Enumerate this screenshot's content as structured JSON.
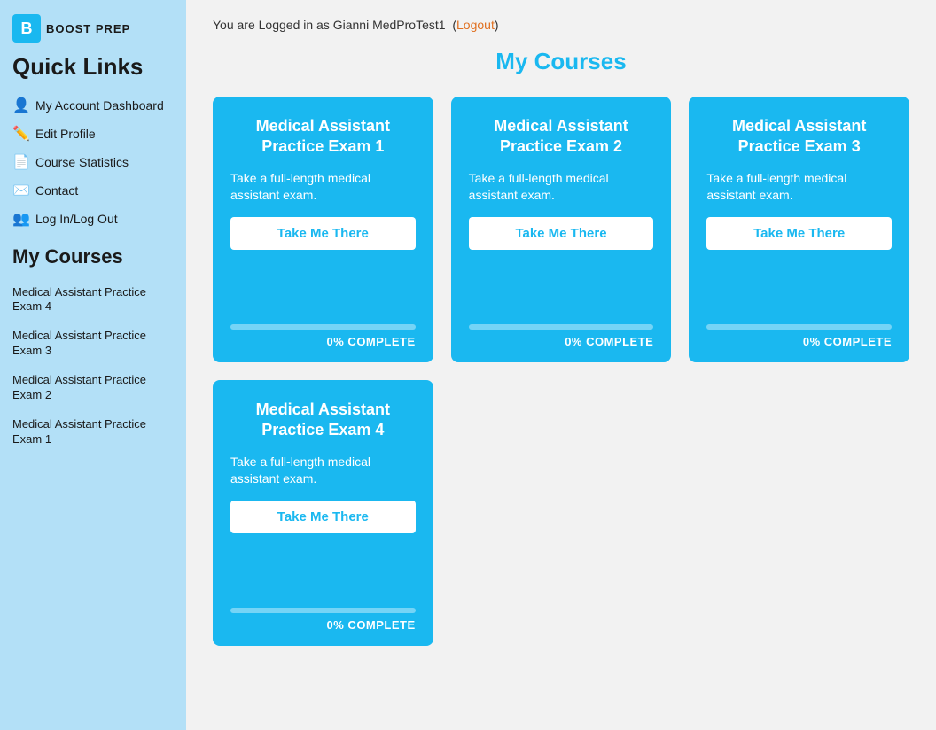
{
  "sidebar": {
    "logo_letter": "B",
    "logo_text": "BOOST PREP",
    "quick_links_label": "Quick Links",
    "nav_items": [
      {
        "id": "account-dashboard",
        "icon": "👤",
        "label": "My Account Dashboard"
      },
      {
        "id": "edit-profile",
        "icon": "✏️",
        "label": "Edit Profile"
      },
      {
        "id": "course-statistics",
        "icon": "📄",
        "label": "Course Statistics"
      },
      {
        "id": "contact",
        "icon": "✉️",
        "label": "Contact"
      },
      {
        "id": "login-logout",
        "icon": "👥",
        "label": "Log In/Log Out"
      }
    ],
    "my_courses_label": "My Courses",
    "course_links": [
      {
        "id": "exam4-link",
        "label": "Medical Assistant Practice Exam 4"
      },
      {
        "id": "exam3-link",
        "label": "Medical Assistant Practice Exam 3"
      },
      {
        "id": "exam2-link",
        "label": "Medical Assistant Practice Exam 2"
      },
      {
        "id": "exam1-link",
        "label": "Medical Assistant Practice Exam 1"
      }
    ]
  },
  "main": {
    "login_status": "You are Logged in as Gianni MedProTest1",
    "logout_label": "Logout",
    "page_title": "My Courses",
    "courses": [
      {
        "id": "exam1",
        "title": "Medical Assistant Practice Exam 1",
        "description": "Take a full-length medical assistant exam.",
        "btn_label": "Take Me There",
        "progress": 0,
        "progress_label": "0% COMPLETE"
      },
      {
        "id": "exam2",
        "title": "Medical Assistant Practice Exam 2",
        "description": "Take a full-length medical assistant exam.",
        "btn_label": "Take Me There",
        "progress": 0,
        "progress_label": "0% COMPLETE"
      },
      {
        "id": "exam3",
        "title": "Medical Assistant Practice Exam 3",
        "description": "Take a full-length medical assistant exam.",
        "btn_label": "Take Me There",
        "progress": 0,
        "progress_label": "0% COMPLETE"
      },
      {
        "id": "exam4",
        "title": "Medical Assistant Practice Exam 4",
        "description": "Take a full-length medical assistant exam.",
        "btn_label": "Take Me There",
        "progress": 0,
        "progress_label": "0% COMPLETE"
      }
    ]
  }
}
